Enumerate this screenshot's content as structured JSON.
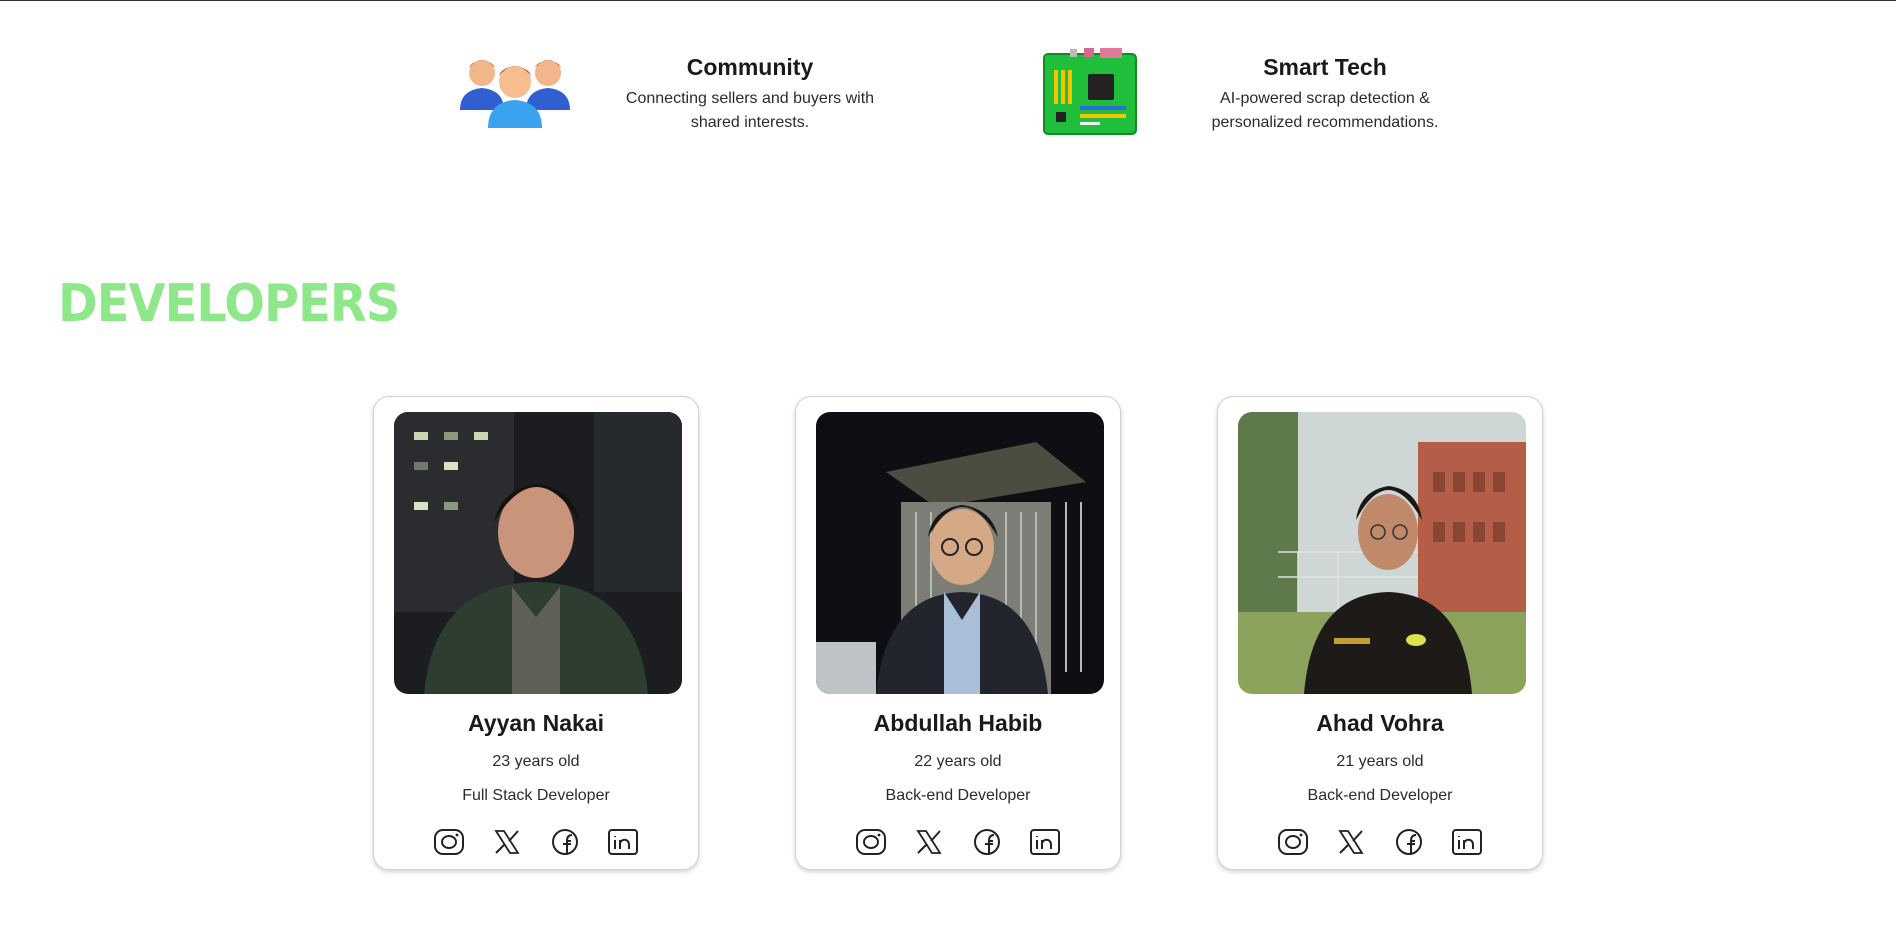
{
  "features": [
    {
      "title": "Community",
      "description": "Connecting sellers and buyers with shared interests.",
      "icon": "people-group-icon"
    },
    {
      "title": "Smart Tech",
      "description": "AI-powered scrap detection & personalized recommendations.",
      "icon": "circuit-board-icon"
    }
  ],
  "developers_section": {
    "heading": "DEVELOPERS",
    "heading_color": "#8ee88a"
  },
  "developers": [
    {
      "name": "Ayyan Nakai",
      "age": "23 years old",
      "role": "Full Stack Developer"
    },
    {
      "name": "Abdullah Habib",
      "age": "22 years old",
      "role": "Back-end Developer"
    },
    {
      "name": "Ahad Vohra",
      "age": "21 years old",
      "role": "Back-end Developer"
    }
  ],
  "social_icons": [
    "instagram-icon",
    "x-icon",
    "facebook-icon",
    "linkedin-icon"
  ]
}
